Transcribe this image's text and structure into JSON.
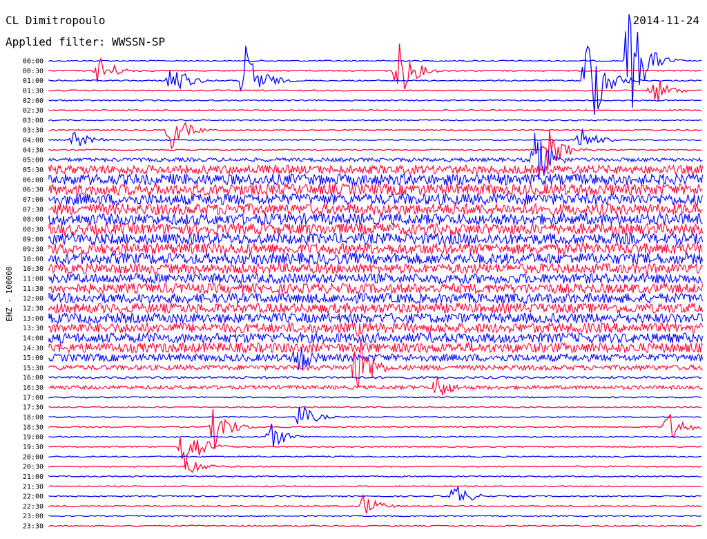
{
  "header": {
    "station": "CL Dimitropoulo",
    "filter": "Applied filter: WWSSN-SP",
    "date": "2014-11-24"
  },
  "channel_label": "EHZ - 100000",
  "colors": {
    "blue": "#0000ff",
    "red": "#ff0033",
    "text": "#000000",
    "background": "#ffffff"
  },
  "chart_data": {
    "type": "line",
    "title": "",
    "xlabel": "",
    "ylabel": "EHZ - 100000",
    "grid": false,
    "legend": "none",
    "trace_colors_alternate": [
      "blue",
      "red"
    ],
    "row_labels": [
      "00:00",
      "00:30",
      "01:00",
      "01:30",
      "02:00",
      "02:30",
      "03:00",
      "03:30",
      "04:00",
      "04:30",
      "05:00",
      "05:30",
      "06:00",
      "06:30",
      "07:00",
      "07:30",
      "08:00",
      "08:30",
      "09:00",
      "09:30",
      "10:00",
      "10:30",
      "11:00",
      "11:30",
      "12:00",
      "12:30",
      "13:00",
      "13:30",
      "14:00",
      "14:30",
      "15:00",
      "15:30",
      "16:00",
      "16:30",
      "17:00",
      "17:30",
      "18:00",
      "18:30",
      "19:00",
      "19:30",
      "20:00",
      "20:30",
      "21:00",
      "21:30",
      "22:00",
      "22:30",
      "23:00",
      "23:30"
    ],
    "noise_level": [
      1,
      1,
      1,
      1,
      1,
      1,
      1,
      1,
      1,
      1,
      3,
      7,
      9,
      9,
      9,
      9,
      9,
      9,
      9,
      9,
      9,
      8,
      8,
      8,
      8,
      8,
      8,
      8,
      8,
      8,
      6,
      4,
      2,
      3,
      1,
      1,
      1,
      1,
      1,
      1,
      1,
      1,
      1,
      1,
      1,
      1,
      1,
      1
    ],
    "events": [
      {
        "row": "00:00",
        "minute": 26.6,
        "amplitude": 90
      },
      {
        "row": "00:30",
        "minute": 2.3,
        "amplitude": 25
      },
      {
        "row": "00:30",
        "minute": 16,
        "amplitude": 45
      },
      {
        "row": "01:00",
        "minute": 9,
        "amplitude": 55
      },
      {
        "row": "01:00",
        "minute": 5.6,
        "amplitude": 30
      },
      {
        "row": "01:00",
        "minute": 24.7,
        "amplitude": 95
      },
      {
        "row": "01:30",
        "minute": 27.7,
        "amplitude": 25
      },
      {
        "row": "03:30",
        "minute": 5.6,
        "amplitude": 30
      },
      {
        "row": "04:00",
        "minute": 24.4,
        "amplitude": 20
      },
      {
        "row": "04:00",
        "minute": 1.2,
        "amplitude": 15
      },
      {
        "row": "04:30",
        "minute": 22.9,
        "amplitude": 35
      },
      {
        "row": "05:00",
        "minute": 22.3,
        "amplitude": 45
      },
      {
        "row": "13:30",
        "minute": 14.1,
        "amplitude": 15
      },
      {
        "row": "15:00",
        "minute": 11.4,
        "amplitude": 30
      },
      {
        "row": "15:30",
        "minute": 14.1,
        "amplitude": 55
      },
      {
        "row": "16:30",
        "minute": 17.8,
        "amplitude": 20
      },
      {
        "row": "18:00",
        "minute": 11.5,
        "amplitude": 20
      },
      {
        "row": "18:30",
        "minute": 7.6,
        "amplitude": 35
      },
      {
        "row": "18:30",
        "minute": 28.4,
        "amplitude": 25
      },
      {
        "row": "19:00",
        "minute": 10.2,
        "amplitude": 20
      },
      {
        "row": "19:30",
        "minute": 6.2,
        "amplitude": 45
      },
      {
        "row": "20:30",
        "minute": 6.5,
        "amplitude": 15
      },
      {
        "row": "22:00",
        "minute": 18.6,
        "amplitude": 20
      },
      {
        "row": "22:30",
        "minute": 14.4,
        "amplitude": 20
      }
    ]
  }
}
